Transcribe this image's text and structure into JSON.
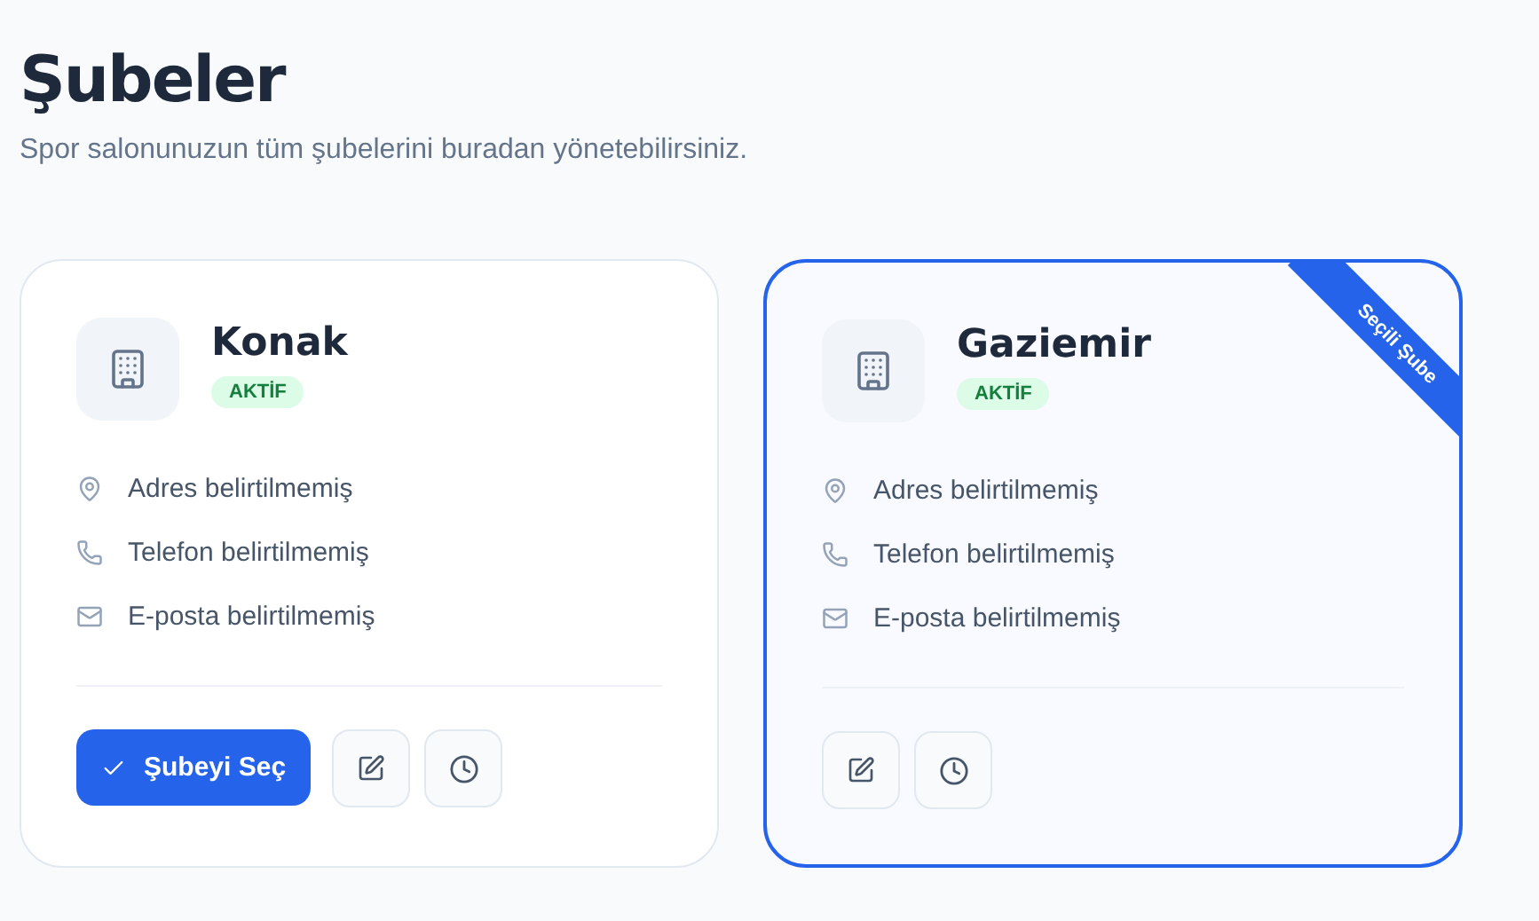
{
  "header": {
    "title": "Şubeler",
    "subtitle": "Spor salonunuzun tüm şubelerini buradan yönetebilirsiniz."
  },
  "branches": [
    {
      "name": "Konak",
      "status": "AKTİF",
      "selected": false,
      "select_button": "Şubeyi Seç",
      "details": [
        {
          "kind": "address",
          "text": "Adres belirtilmemiş"
        },
        {
          "kind": "phone",
          "text": "Telefon belirtilmemiş"
        },
        {
          "kind": "email",
          "text": "E-posta belirtilmemiş"
        }
      ]
    },
    {
      "name": "Gaziemir",
      "status": "AKTİF",
      "selected": true,
      "ribbon": "Seçili Şube",
      "details": [
        {
          "kind": "address",
          "text": "Adres belirtilmemiş"
        },
        {
          "kind": "phone",
          "text": "Telefon belirtilmemiş"
        },
        {
          "kind": "email",
          "text": "E-posta belirtilmemiş"
        }
      ]
    }
  ]
}
